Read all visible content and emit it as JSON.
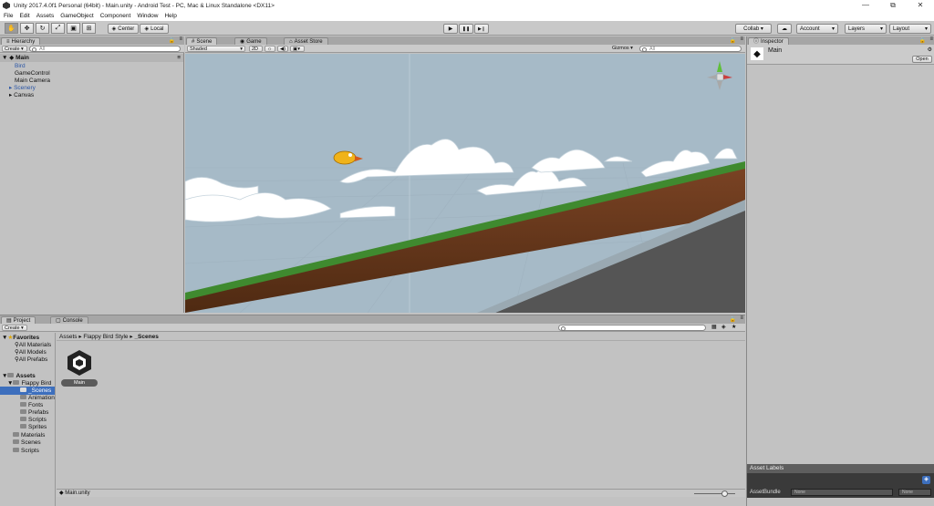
{
  "window": {
    "title": "Unity 2017.4.0f1 Personal (64bit) - Main.unity - Android Test - PC, Mac & Linux Standalone <DX11>",
    "minimize": "—",
    "maximize": "⧉",
    "close": "✕"
  },
  "menu": [
    "File",
    "Edit",
    "Assets",
    "GameObject",
    "Component",
    "Window",
    "Help"
  ],
  "toolbar": {
    "pivot_label": "Center",
    "space_label": "Local",
    "collab_label": "Collab ▾",
    "account_label": "Account",
    "layers_label": "Layers",
    "layout_label": "Layout",
    "play_icon": "▶",
    "pause_icon": "❚❚",
    "step_icon": "▶❙"
  },
  "hierarchy": {
    "tab_label": "Hierarchy",
    "create_label": "Create",
    "search_placeholder": "All",
    "scene_name": "Main",
    "items": [
      {
        "label": "Bird",
        "selected": true
      },
      {
        "label": "GameControl"
      },
      {
        "label": "Main Camera"
      },
      {
        "label": "Scenery",
        "expandable": true
      },
      {
        "label": "Canvas",
        "expandable": true
      }
    ]
  },
  "scene": {
    "tabs": [
      "Scene",
      "Game",
      "Asset Store"
    ],
    "shading_mode": "Shaded",
    "mode_2d": "2D",
    "gizmos_label": "Gizmos",
    "search_placeholder": "All"
  },
  "inspector": {
    "tab_label": "Inspector",
    "asset_name": "Main",
    "open_button": "Open",
    "asset_labels": "Asset Labels",
    "asset_bundle_label": "AssetBundle",
    "bundle_value": "None",
    "variant_value": "None"
  },
  "project": {
    "tabs": [
      "Project",
      "Console"
    ],
    "create_label": "Create",
    "favorites_label": "Favorites",
    "favorites": [
      "All Materials",
      "All Models",
      "All Prefabs"
    ],
    "assets_label": "Assets",
    "tree": [
      {
        "label": "Flappy Bird",
        "level": 1
      },
      {
        "label": "_Scenes",
        "level": 2,
        "selected": true
      },
      {
        "label": "Animation",
        "level": 2
      },
      {
        "label": "Fonts",
        "level": 2
      },
      {
        "label": "Prefabs",
        "level": 2
      },
      {
        "label": "Scripts",
        "level": 2
      },
      {
        "label": "Sprites",
        "level": 2
      },
      {
        "label": "Materials",
        "level": 1
      },
      {
        "label": "Scenes",
        "level": 1
      },
      {
        "label": "Scripts",
        "level": 1
      }
    ],
    "breadcrumb": [
      "Assets",
      "Flappy Bird Style",
      "_Scenes"
    ],
    "file_name": "Main",
    "status_file": "Main.unity"
  },
  "colors": {
    "selection": "#3d6fbd",
    "sky": "#a7bcc9",
    "ground": "#6b3a1c",
    "grass": "#3f8a2f"
  }
}
